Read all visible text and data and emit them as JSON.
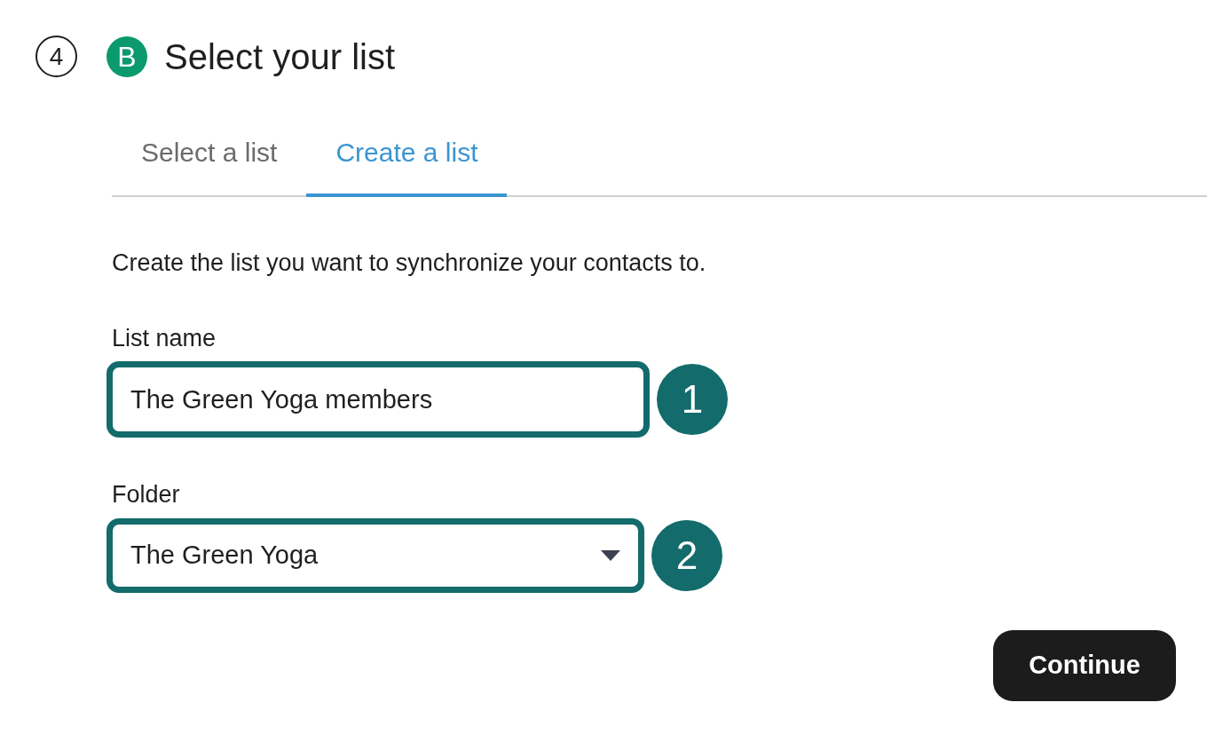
{
  "step": {
    "number": "4",
    "logo_letter": "B",
    "title": "Select your list"
  },
  "tabs": [
    {
      "label": "Select a list",
      "selected": false
    },
    {
      "label": "Create a list",
      "selected": true
    }
  ],
  "description": "Create the list you want to synchronize your contacts to.",
  "fields": [
    {
      "kind": "text",
      "label": "List name",
      "value": "The Green Yoga members",
      "badge": "1"
    },
    {
      "kind": "select",
      "label": "Folder",
      "value": "The Green Yoga",
      "badge": "2"
    }
  ],
  "button": "Continue"
}
